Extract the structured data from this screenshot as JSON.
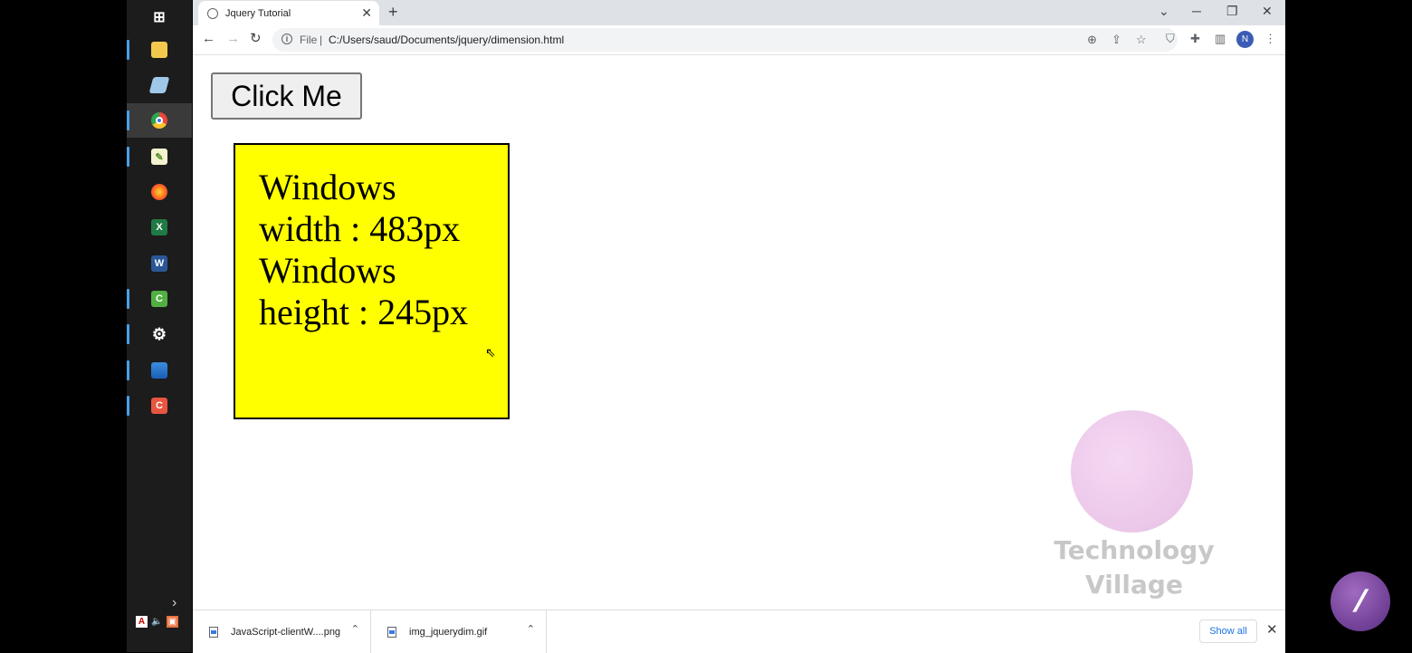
{
  "taskbar": {
    "items": [
      {
        "icon": "windows-start-icon",
        "color": "#ffffff",
        "glyph": "⊞"
      },
      {
        "icon": "file-explorer-icon",
        "color": "#f2c94c",
        "glyph": "▬"
      },
      {
        "icon": "app-icon",
        "color": "#9fc8e8",
        "glyph": "▰"
      },
      {
        "icon": "chrome-icon",
        "color": "#e9473d",
        "glyph": "◉"
      },
      {
        "icon": "notepad-icon",
        "color": "#7bbf4b",
        "glyph": "✎"
      },
      {
        "icon": "firefox-icon",
        "color": "#ff7a1a",
        "glyph": "●"
      },
      {
        "icon": "excel-icon",
        "color": "#1f7a44",
        "glyph": "X"
      },
      {
        "icon": "word-icon",
        "color": "#2b5797",
        "glyph": "W"
      },
      {
        "icon": "camtasia-green-icon",
        "color": "#52b043",
        "glyph": "C"
      },
      {
        "icon": "settings-icon",
        "color": "#1c1c1c",
        "glyph": "⚙"
      },
      {
        "icon": "photos-icon",
        "color": "#3c8ce0",
        "glyph": "▲"
      },
      {
        "icon": "camtasia-red-icon",
        "color": "#e8563f",
        "glyph": "C"
      }
    ]
  },
  "browser": {
    "tab_title": "Jquery Tutorial",
    "url_scheme": "File",
    "url_separator": "|",
    "url": "C:/Users/saud/Documents/jquery/dimension.html",
    "profile_initial": "N"
  },
  "page": {
    "button_label": "Click Me",
    "box_lines": [
      "Windows",
      "width : 483px",
      "Windows",
      "height : 245px"
    ],
    "box_color": "#ffff00"
  },
  "watermark": {
    "line1": "Technology",
    "line2": "Village"
  },
  "downloads": {
    "items": [
      {
        "name": "JavaScript-clientW....png"
      },
      {
        "name": "img_jquerydim.gif"
      }
    ],
    "show_all": "Show all"
  }
}
